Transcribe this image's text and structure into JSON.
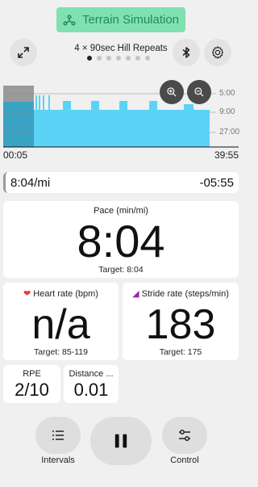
{
  "header": {
    "terrain_label": "Terrain Simulation",
    "workout_title": "4 × 90sec Hill Repeats",
    "page_count": 7,
    "active_page": 0
  },
  "chart_data": {
    "type": "area",
    "y_ticks": [
      "5:00",
      "9:00",
      "27:00"
    ],
    "x_start": "00:05",
    "x_end": "39:55"
  },
  "pace_bar": {
    "current": "8:04/mi",
    "delta": "-05:55"
  },
  "pace": {
    "label": "Pace (min/mi)",
    "value": "8:04",
    "target": "Target: 8:04"
  },
  "heart": {
    "label": "Heart rate (bpm)",
    "value": "n/a",
    "target": "Target: 85-119"
  },
  "stride": {
    "label": "Stride rate (steps/min)",
    "value": "183",
    "target": "Target: 175"
  },
  "rpe": {
    "label": "RPE",
    "value": "2/10"
  },
  "distance": {
    "label": "Distance ...",
    "value": "0.01"
  },
  "controls": {
    "intervals_label": "Intervals",
    "control_label": "Control"
  },
  "colors": {
    "accent_green": "#7fe0b0",
    "chart_fill": "#5bd3f6",
    "chart_dark": "#3aa3c4"
  }
}
